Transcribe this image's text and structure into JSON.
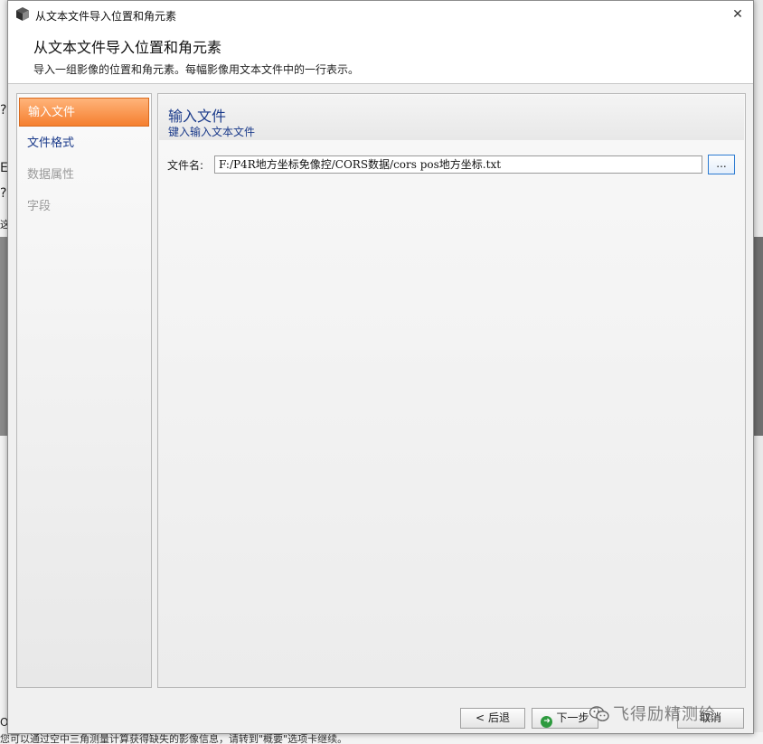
{
  "window": {
    "title": "从文本文件导入位置和角元素",
    "close_glyph": "✕"
  },
  "header": {
    "title": "从文本文件导入位置和角元素",
    "description": "导入一组影像的位置和角元素。每幅影像用文本文件中的一行表示。"
  },
  "nav": {
    "items": [
      {
        "label": "输入文件",
        "state": "active"
      },
      {
        "label": "文件格式",
        "state": "normal"
      },
      {
        "label": "数据属性",
        "state": "disabled"
      },
      {
        "label": "字段",
        "state": "disabled"
      }
    ]
  },
  "panel": {
    "title": "输入文件",
    "subtitle": "键入输入文本文件",
    "file_label": "文件名:",
    "file_value": "F:/P4R地方坐标免像控/CORS数据/cors pos地方坐标.txt",
    "browse_label": "..."
  },
  "footer": {
    "back_label": "后退",
    "next_label": "下一步",
    "cancel_label": "取消"
  },
  "watermark": {
    "text": "飞得励精测绘"
  },
  "background": {
    "status_text": "您可以通过空中三角测量计算获得缺失的影像信息，请转到\"概要\"选项卡继续。",
    "left_chars": [
      "?",
      "E",
      "?",
      "这"
    ],
    "bottom_left_char": "O"
  },
  "colors": {
    "nav_active": "#f57f2f",
    "nav_link": "#1a3a8a",
    "browse_border": "#2c7bd1",
    "next_icon": "#2d9a3e"
  },
  "icons": {
    "app": "app-cube-icon",
    "close": "close-icon",
    "back": "chevron-left-icon",
    "next": "go-arrow-icon",
    "watermark": "wechat-icon"
  }
}
